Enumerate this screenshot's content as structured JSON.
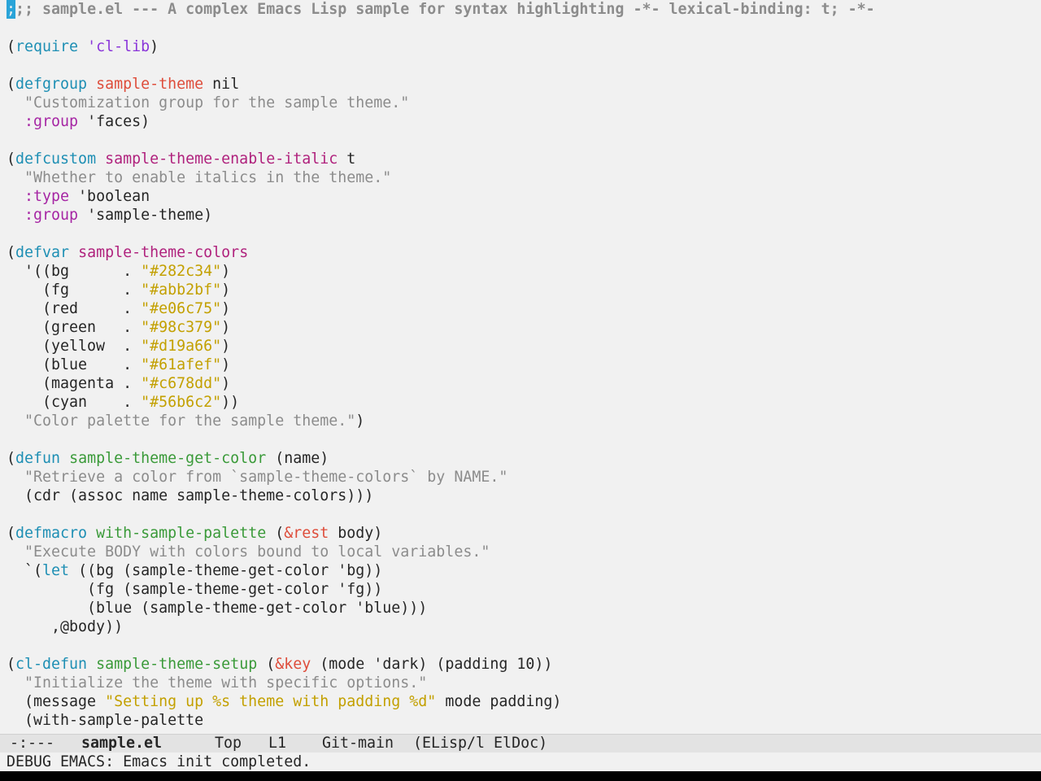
{
  "buffer": {
    "lines": [
      [
        {
          "t": ";",
          "c": "cursor"
        },
        {
          "t": ";; sample.el --- A complex Emacs Lisp sample for syntax highlighting -*- lexical-binding: t; -*-",
          "c": "comment"
        }
      ],
      [],
      [
        {
          "t": "(",
          "c": "plain"
        },
        {
          "t": "require",
          "c": "keyword"
        },
        {
          "t": " ",
          "c": "plain"
        },
        {
          "t": "'cl-lib",
          "c": "builtin"
        },
        {
          "t": ")",
          "c": "plain"
        }
      ],
      [],
      [
        {
          "t": "(",
          "c": "plain"
        },
        {
          "t": "defgroup",
          "c": "keyword"
        },
        {
          "t": " ",
          "c": "plain"
        },
        {
          "t": "sample-theme",
          "c": "type"
        },
        {
          "t": " nil",
          "c": "plain"
        }
      ],
      [
        {
          "t": "  ",
          "c": "plain"
        },
        {
          "t": "\"Customization group for the sample theme.\"",
          "c": "doc"
        }
      ],
      [
        {
          "t": "  ",
          "c": "plain"
        },
        {
          "t": ":group",
          "c": "const"
        },
        {
          "t": " 'faces)",
          "c": "plain"
        }
      ],
      [],
      [
        {
          "t": "(",
          "c": "plain"
        },
        {
          "t": "defcustom",
          "c": "keyword"
        },
        {
          "t": " ",
          "c": "plain"
        },
        {
          "t": "sample-theme-enable-italic",
          "c": "var"
        },
        {
          "t": " t",
          "c": "plain"
        }
      ],
      [
        {
          "t": "  ",
          "c": "plain"
        },
        {
          "t": "\"Whether to enable italics in the theme.\"",
          "c": "doc"
        }
      ],
      [
        {
          "t": "  ",
          "c": "plain"
        },
        {
          "t": ":type",
          "c": "const"
        },
        {
          "t": " 'boolean",
          "c": "plain"
        }
      ],
      [
        {
          "t": "  ",
          "c": "plain"
        },
        {
          "t": ":group",
          "c": "const"
        },
        {
          "t": " 'sample-theme)",
          "c": "plain"
        }
      ],
      [],
      [
        {
          "t": "(",
          "c": "plain"
        },
        {
          "t": "defvar",
          "c": "keyword"
        },
        {
          "t": " ",
          "c": "plain"
        },
        {
          "t": "sample-theme-colors",
          "c": "var"
        }
      ],
      [
        {
          "t": "  '((bg      . ",
          "c": "plain"
        },
        {
          "t": "\"#282c34\"",
          "c": "string"
        },
        {
          "t": ")",
          "c": "plain"
        }
      ],
      [
        {
          "t": "    (fg      . ",
          "c": "plain"
        },
        {
          "t": "\"#abb2bf\"",
          "c": "string"
        },
        {
          "t": ")",
          "c": "plain"
        }
      ],
      [
        {
          "t": "    (red     . ",
          "c": "plain"
        },
        {
          "t": "\"#e06c75\"",
          "c": "string"
        },
        {
          "t": ")",
          "c": "plain"
        }
      ],
      [
        {
          "t": "    (green   . ",
          "c": "plain"
        },
        {
          "t": "\"#98c379\"",
          "c": "string"
        },
        {
          "t": ")",
          "c": "plain"
        }
      ],
      [
        {
          "t": "    (yellow  . ",
          "c": "plain"
        },
        {
          "t": "\"#d19a66\"",
          "c": "string"
        },
        {
          "t": ")",
          "c": "plain"
        }
      ],
      [
        {
          "t": "    (blue    . ",
          "c": "plain"
        },
        {
          "t": "\"#61afef\"",
          "c": "string"
        },
        {
          "t": ")",
          "c": "plain"
        }
      ],
      [
        {
          "t": "    (magenta . ",
          "c": "plain"
        },
        {
          "t": "\"#c678dd\"",
          "c": "string"
        },
        {
          "t": ")",
          "c": "plain"
        }
      ],
      [
        {
          "t": "    (cyan    . ",
          "c": "plain"
        },
        {
          "t": "\"#56b6c2\"",
          "c": "string"
        },
        {
          "t": "))",
          "c": "plain"
        }
      ],
      [
        {
          "t": "  ",
          "c": "plain"
        },
        {
          "t": "\"Color palette for the sample theme.\"",
          "c": "doc"
        },
        {
          "t": ")",
          "c": "plain"
        }
      ],
      [],
      [
        {
          "t": "(",
          "c": "plain"
        },
        {
          "t": "defun",
          "c": "keyword"
        },
        {
          "t": " ",
          "c": "plain"
        },
        {
          "t": "sample-theme-get-color",
          "c": "func"
        },
        {
          "t": " (name)",
          "c": "plain"
        }
      ],
      [
        {
          "t": "  ",
          "c": "plain"
        },
        {
          "t": "\"Retrieve a color from `sample-theme-colors` by NAME.\"",
          "c": "doc"
        }
      ],
      [
        {
          "t": "  (cdr (assoc name sample-theme-colors)))",
          "c": "plain"
        }
      ],
      [],
      [
        {
          "t": "(",
          "c": "plain"
        },
        {
          "t": "defmacro",
          "c": "keyword"
        },
        {
          "t": " ",
          "c": "plain"
        },
        {
          "t": "with-sample-palette",
          "c": "func"
        },
        {
          "t": " (",
          "c": "plain"
        },
        {
          "t": "&rest",
          "c": "type"
        },
        {
          "t": " body)",
          "c": "plain"
        }
      ],
      [
        {
          "t": "  ",
          "c": "plain"
        },
        {
          "t": "\"Execute BODY with colors bound to local variables.\"",
          "c": "doc"
        }
      ],
      [
        {
          "t": "  `(",
          "c": "plain"
        },
        {
          "t": "let",
          "c": "keyword"
        },
        {
          "t": " ((bg (sample-theme-get-color 'bg))",
          "c": "plain"
        }
      ],
      [
        {
          "t": "         (fg (sample-theme-get-color 'fg))",
          "c": "plain"
        }
      ],
      [
        {
          "t": "         (blue (sample-theme-get-color 'blue)))",
          "c": "plain"
        }
      ],
      [
        {
          "t": "     ,@body))",
          "c": "plain"
        }
      ],
      [],
      [
        {
          "t": "(",
          "c": "plain"
        },
        {
          "t": "cl-defun",
          "c": "keyword"
        },
        {
          "t": " ",
          "c": "plain"
        },
        {
          "t": "sample-theme-setup",
          "c": "func"
        },
        {
          "t": " (",
          "c": "plain"
        },
        {
          "t": "&key",
          "c": "type"
        },
        {
          "t": " (mode 'dark) (padding 10))",
          "c": "plain"
        }
      ],
      [
        {
          "t": "  ",
          "c": "plain"
        },
        {
          "t": "\"Initialize the theme with specific options.\"",
          "c": "doc"
        }
      ],
      [
        {
          "t": "  (message ",
          "c": "plain"
        },
        {
          "t": "\"Setting up %s theme with padding %d\"",
          "c": "string"
        },
        {
          "t": " mode padding)",
          "c": "plain"
        }
      ],
      [
        {
          "t": "  (with-sample-palette",
          "c": "plain"
        }
      ]
    ]
  },
  "modeline": {
    "status": "-:---",
    "buffer_name": "sample.el",
    "position": "Top",
    "line": "L1",
    "vc": "Git-main",
    "mode": "(ELisp/l ElDoc)"
  },
  "echo_area": {
    "message": "DEBUG EMACS: Emacs init completed."
  },
  "colors": {
    "background": "#f1f1f1",
    "foreground": "#262626",
    "comment": "#8c8c8c",
    "keyword": "#1e8fb4",
    "builtin": "#8a35d9",
    "constant": "#a626a4",
    "variable": "#b0227d",
    "type": "#de4d3b",
    "function": "#3a9a39",
    "string": "#c3a000",
    "cursor": "#2aa4d8",
    "modeline_bg": "#e3e3e3"
  }
}
